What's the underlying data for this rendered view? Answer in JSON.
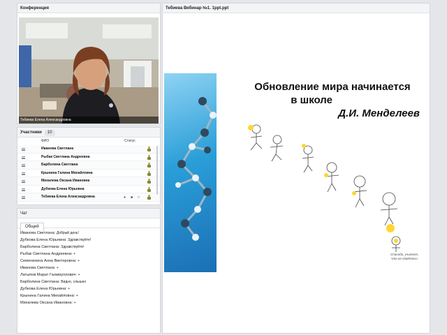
{
  "conference": {
    "title": "Конференция",
    "video_name": "Тебиева Елена Александровна"
  },
  "participants": {
    "title": "Участники",
    "count": "10",
    "col_fio": "ФИО",
    "col_status": "Статус",
    "rows": [
      "Иванова Светлана",
      "Рыбак Светлана  Андреевна",
      "Барболина Светлана",
      "Крынина Галина Михайловна",
      "Михалева Оксана  Ивановна",
      "Дубкова Елена  Юрьевна",
      "Тебиева Елена Александровна"
    ]
  },
  "chat": {
    "title": "Чат",
    "tab": "Общий",
    "messages": [
      {
        "who": "Иванова Светлана:",
        "text": "Добрый день!"
      },
      {
        "who": "Дубкова Елена  Юрьевна:",
        "text": "Здравствуйте!"
      },
      {
        "who": "Барболина Светлана:",
        "text": "Здравствуйте!"
      },
      {
        "who": "Рыбак Светлана  Андреевна:",
        "text": "+"
      },
      {
        "who": "Семенихина Анна  Викторовна:",
        "text": "+"
      },
      {
        "who": "Иванова Светлана:",
        "text": "+"
      },
      {
        "who": "Латыпов Марат  Галимуллович:",
        "text": "+"
      },
      {
        "who": "Барболина Светлана:",
        "text": "Видно, слышно"
      },
      {
        "who": "Дубкова Елена  Юрьевна:",
        "text": "+"
      },
      {
        "who": "Крынина Галина Михайловна:",
        "text": "+"
      },
      {
        "who": "Михалева Оксана  Ивановна:",
        "text": "+"
      }
    ]
  },
  "presentation": {
    "title": "Тебиева Вебинар №1. 1ppt.ppt",
    "slide_line1": "Обновление мира начинается",
    "slide_line2": "в школе",
    "slide_line3": "Д.И. Менделеев",
    "caption_line1": "Спасибо, учителя,",
    "caption_line2": "что не сдаётесь!"
  },
  "colors": {
    "accent_blue": "#2a9ed8",
    "panel_bg": "#ffffff",
    "app_bg": "#e4e6ea"
  }
}
